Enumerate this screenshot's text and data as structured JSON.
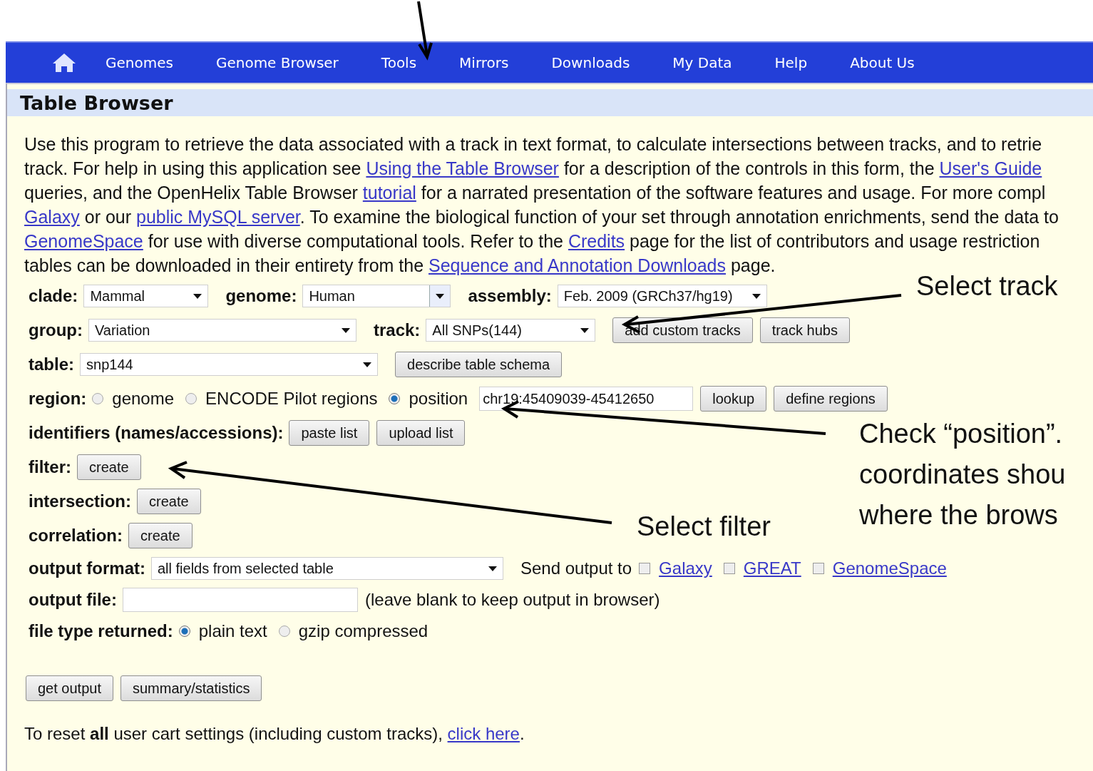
{
  "nav": {
    "items": [
      {
        "label": "Genomes"
      },
      {
        "label": "Genome Browser"
      },
      {
        "label": "Tools"
      },
      {
        "label": "Mirrors"
      },
      {
        "label": "Downloads"
      },
      {
        "label": "My Data"
      },
      {
        "label": "Help"
      },
      {
        "label": "About Us"
      }
    ]
  },
  "title": "Table Browser",
  "intro": [
    [
      {
        "kind": "text",
        "text": "Use this program to retrieve the data associated with a track in text format, to calculate intersections between tracks, and to retrie"
      }
    ],
    [
      {
        "kind": "text",
        "text": "track. For help in using this application see "
      },
      {
        "kind": "link",
        "text": "Using the Table Browser"
      },
      {
        "kind": "text",
        "text": " for a description of the controls in this form, the "
      },
      {
        "kind": "link",
        "text": "User's Guide"
      }
    ],
    [
      {
        "kind": "text",
        "text": "queries, and the OpenHelix Table Browser "
      },
      {
        "kind": "link",
        "text": "tutorial"
      },
      {
        "kind": "text",
        "text": " for a narrated presentation of the software features and usage. For more compl"
      }
    ],
    [
      {
        "kind": "link",
        "text": "Galaxy"
      },
      {
        "kind": "text",
        "text": " or our "
      },
      {
        "kind": "link",
        "text": "public MySQL server"
      },
      {
        "kind": "text",
        "text": ". To examine the biological function of your set through annotation enrichments, send the data to"
      }
    ],
    [
      {
        "kind": "link",
        "text": "GenomeSpace"
      },
      {
        "kind": "text",
        "text": " for use with diverse computational tools. Refer to the "
      },
      {
        "kind": "link",
        "text": "Credits"
      },
      {
        "kind": "text",
        "text": " page for the list of contributors and usage restriction"
      }
    ],
    [
      {
        "kind": "text",
        "text": "tables can be downloaded in their entirety from the "
      },
      {
        "kind": "link",
        "text": "Sequence and Annotation Downloads"
      },
      {
        "kind": "text",
        "text": " page."
      }
    ]
  ],
  "form": [
    {
      "items": [
        {
          "kind": "label",
          "text": "clade:"
        },
        {
          "kind": "select",
          "text": "Mammal"
        },
        {
          "kind": "label",
          "text": "genome:"
        },
        {
          "kind": "combo",
          "text": "Human"
        },
        {
          "kind": "label",
          "text": "assembly:"
        },
        {
          "kind": "select",
          "text": "Feb. 2009 (GRCh37/hg19)"
        }
      ]
    },
    {
      "items": [
        {
          "kind": "label",
          "text": "group:"
        },
        {
          "kind": "select",
          "text": "Variation"
        },
        {
          "kind": "label",
          "text": "track:"
        },
        {
          "kind": "select",
          "text": "All SNPs(144)"
        },
        {
          "kind": "button",
          "text": "add custom tracks"
        },
        {
          "kind": "button",
          "text": "track hubs"
        }
      ]
    },
    {
      "items": [
        {
          "kind": "label",
          "text": "table:"
        },
        {
          "kind": "select",
          "text": "snp144"
        },
        {
          "kind": "button",
          "text": "describe table schema"
        }
      ]
    },
    {
      "items": [
        {
          "kind": "label",
          "text": "region:"
        },
        {
          "kind": "radio",
          "text": "genome",
          "selected": false
        },
        {
          "kind": "radio",
          "text": "ENCODE Pilot regions",
          "selected": false
        },
        {
          "kind": "radio",
          "text": "position",
          "selected": true
        },
        {
          "kind": "input",
          "text": "chr19:45409039-45412650"
        },
        {
          "kind": "button",
          "text": "lookup"
        },
        {
          "kind": "button",
          "text": "define regions"
        }
      ]
    },
    {
      "items": [
        {
          "kind": "label",
          "text": "identifiers (names/accessions):"
        },
        {
          "kind": "button",
          "text": "paste list"
        },
        {
          "kind": "button",
          "text": "upload list"
        }
      ]
    },
    {
      "items": [
        {
          "kind": "label",
          "text": "filter:"
        },
        {
          "kind": "button",
          "text": "create"
        }
      ]
    },
    {
      "items": [
        {
          "kind": "label",
          "text": "intersection:"
        },
        {
          "kind": "button",
          "text": "create"
        }
      ]
    },
    {
      "items": [
        {
          "kind": "label",
          "text": "correlation:"
        },
        {
          "kind": "button",
          "text": "create"
        }
      ]
    },
    {
      "items": [
        {
          "kind": "label",
          "text": "output format:"
        },
        {
          "kind": "select",
          "text": "all fields from selected table"
        },
        {
          "kind": "text",
          "text": "Send output to"
        },
        {
          "kind": "check",
          "text": "Galaxy",
          "checked": false
        },
        {
          "kind": "check",
          "text": "GREAT",
          "checked": false
        },
        {
          "kind": "check",
          "text": "GenomeSpace",
          "checked": false
        }
      ]
    },
    {
      "items": [
        {
          "kind": "label",
          "text": "output file:"
        },
        {
          "kind": "input"
        },
        {
          "kind": "text",
          "text": "(leave blank to keep output in browser)"
        }
      ]
    },
    {
      "items": [
        {
          "kind": "label",
          "text": "file type returned:"
        },
        {
          "kind": "radio",
          "text": "plain text",
          "selected": true
        },
        {
          "kind": "radio",
          "text": "gzip compressed",
          "selected": false
        }
      ]
    }
  ],
  "actions": [
    {
      "label": "get output"
    },
    {
      "label": "summary/statistics"
    }
  ],
  "footer": {
    "text": "To reset **all** user cart settings (including custom tracks), ",
    "link": "click here",
    "end": "."
  },
  "callouts": [
    {
      "lines": [
        "Select track"
      ]
    },
    {
      "lines": [
        "Check “position”.",
        "coordinates shou",
        "where the brows"
      ]
    },
    {
      "lines": [
        "Select filter"
      ]
    }
  ]
}
